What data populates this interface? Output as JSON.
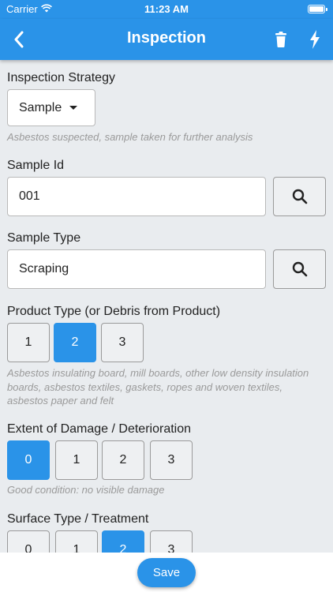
{
  "status_bar": {
    "carrier": "Carrier",
    "time": "11:23 AM"
  },
  "app_bar": {
    "title": "Inspection"
  },
  "inspection_strategy": {
    "label": "Inspection Strategy",
    "selected": "Sample",
    "hint": "Asbestos suspected, sample taken for further analysis"
  },
  "sample_id": {
    "label": "Sample Id",
    "value": "001"
  },
  "sample_type": {
    "label": "Sample Type",
    "value": "Scraping"
  },
  "product_type": {
    "label": "Product Type (or Debris from Product)",
    "options": [
      "1",
      "2",
      "3"
    ],
    "selected": "2",
    "hint": "Asbestos insulating board, mill boards, other low density insulation boards, asbestos textiles, gaskets, ropes and woven textiles, asbestos paper and felt"
  },
  "extent_of_damage": {
    "label": "Extent of Damage / Deterioration",
    "options": [
      "0",
      "1",
      "2",
      "3"
    ],
    "selected": "0",
    "hint": "Good condition: no visible damage"
  },
  "surface_type": {
    "label": "Surface Type / Treatment",
    "options": [
      "0",
      "1",
      "2",
      "3"
    ],
    "selected": "2"
  },
  "footer": {
    "save_label": "Save"
  },
  "colors": {
    "primary": "#2a93e8",
    "background": "#e9ecef",
    "hint": "#9a9a9a"
  }
}
